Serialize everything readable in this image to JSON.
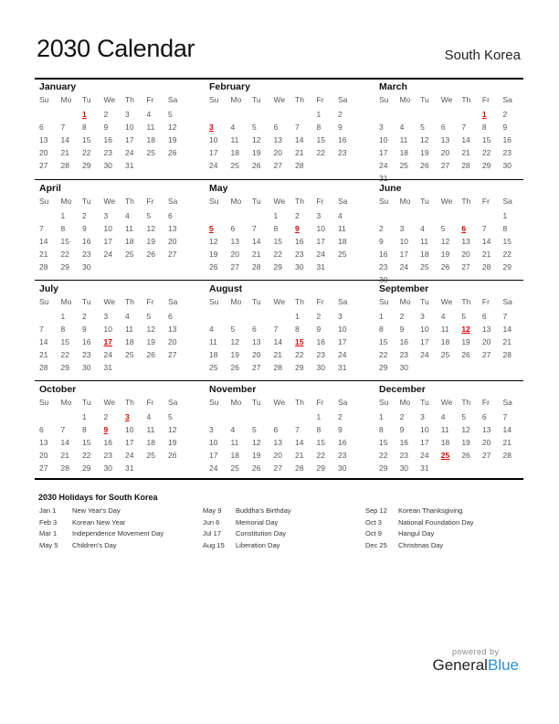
{
  "header": {
    "title": "2030 Calendar",
    "country": "South Korea"
  },
  "weekdays": [
    "Su",
    "Mo",
    "Tu",
    "We",
    "Th",
    "Fr",
    "Sa"
  ],
  "holiday_color": "#e00000",
  "months": [
    {
      "name": "January",
      "weeks": [
        [
          "",
          "",
          "1",
          "2",
          "3",
          "4",
          "5"
        ],
        [
          "6",
          "7",
          "8",
          "9",
          "10",
          "11",
          "12"
        ],
        [
          "13",
          "14",
          "15",
          "16",
          "17",
          "18",
          "19"
        ],
        [
          "20",
          "21",
          "22",
          "23",
          "24",
          "25",
          "26"
        ],
        [
          "27",
          "28",
          "29",
          "30",
          "31",
          "",
          ""
        ]
      ],
      "holidays": [
        "1"
      ]
    },
    {
      "name": "February",
      "weeks": [
        [
          "",
          "",
          "",
          "",
          "",
          "1",
          "2"
        ],
        [
          "3",
          "4",
          "5",
          "6",
          "7",
          "8",
          "9"
        ],
        [
          "10",
          "11",
          "12",
          "13",
          "14",
          "15",
          "16"
        ],
        [
          "17",
          "18",
          "19",
          "20",
          "21",
          "22",
          "23"
        ],
        [
          "24",
          "25",
          "26",
          "27",
          "28",
          "",
          ""
        ]
      ],
      "holidays": [
        "3"
      ]
    },
    {
      "name": "March",
      "weeks": [
        [
          "",
          "",
          "",
          "",
          "",
          "1",
          "2"
        ],
        [
          "3",
          "4",
          "5",
          "6",
          "7",
          "8",
          "9"
        ],
        [
          "10",
          "11",
          "12",
          "13",
          "14",
          "15",
          "16"
        ],
        [
          "17",
          "18",
          "19",
          "20",
          "21",
          "22",
          "23"
        ],
        [
          "24",
          "25",
          "26",
          "27",
          "28",
          "29",
          "30"
        ],
        [
          "31",
          "",
          "",
          "",
          "",
          "",
          ""
        ]
      ],
      "holidays": [
        "1"
      ]
    },
    {
      "name": "April",
      "weeks": [
        [
          "",
          "1",
          "2",
          "3",
          "4",
          "5",
          "6"
        ],
        [
          "7",
          "8",
          "9",
          "10",
          "11",
          "12",
          "13"
        ],
        [
          "14",
          "15",
          "16",
          "17",
          "18",
          "19",
          "20"
        ],
        [
          "21",
          "22",
          "23",
          "24",
          "25",
          "26",
          "27"
        ],
        [
          "28",
          "29",
          "30",
          "",
          "",
          "",
          ""
        ]
      ],
      "holidays": []
    },
    {
      "name": "May",
      "weeks": [
        [
          "",
          "",
          "",
          "1",
          "2",
          "3",
          "4"
        ],
        [
          "5",
          "6",
          "7",
          "8",
          "9",
          "10",
          "11"
        ],
        [
          "12",
          "13",
          "14",
          "15",
          "16",
          "17",
          "18"
        ],
        [
          "19",
          "20",
          "21",
          "22",
          "23",
          "24",
          "25"
        ],
        [
          "26",
          "27",
          "28",
          "29",
          "30",
          "31",
          ""
        ]
      ],
      "holidays": [
        "5",
        "9"
      ]
    },
    {
      "name": "June",
      "weeks": [
        [
          "",
          "",
          "",
          "",
          "",
          "",
          "1"
        ],
        [
          "2",
          "3",
          "4",
          "5",
          "6",
          "7",
          "8"
        ],
        [
          "9",
          "10",
          "11",
          "12",
          "13",
          "14",
          "15"
        ],
        [
          "16",
          "17",
          "18",
          "19",
          "20",
          "21",
          "22"
        ],
        [
          "23",
          "24",
          "25",
          "26",
          "27",
          "28",
          "29"
        ],
        [
          "30",
          "",
          "",
          "",
          "",
          "",
          ""
        ]
      ],
      "holidays": [
        "6"
      ]
    },
    {
      "name": "July",
      "weeks": [
        [
          "",
          "1",
          "2",
          "3",
          "4",
          "5",
          "6"
        ],
        [
          "7",
          "8",
          "9",
          "10",
          "11",
          "12",
          "13"
        ],
        [
          "14",
          "15",
          "16",
          "17",
          "18",
          "19",
          "20"
        ],
        [
          "21",
          "22",
          "23",
          "24",
          "25",
          "26",
          "27"
        ],
        [
          "28",
          "29",
          "30",
          "31",
          "",
          "",
          ""
        ]
      ],
      "holidays": [
        "17"
      ]
    },
    {
      "name": "August",
      "weeks": [
        [
          "",
          "",
          "",
          "",
          "1",
          "2",
          "3"
        ],
        [
          "4",
          "5",
          "6",
          "7",
          "8",
          "9",
          "10"
        ],
        [
          "11",
          "12",
          "13",
          "14",
          "15",
          "16",
          "17"
        ],
        [
          "18",
          "19",
          "20",
          "21",
          "22",
          "23",
          "24"
        ],
        [
          "25",
          "26",
          "27",
          "28",
          "29",
          "30",
          "31"
        ]
      ],
      "holidays": [
        "15"
      ]
    },
    {
      "name": "September",
      "weeks": [
        [
          "1",
          "2",
          "3",
          "4",
          "5",
          "6",
          "7"
        ],
        [
          "8",
          "9",
          "10",
          "11",
          "12",
          "13",
          "14"
        ],
        [
          "15",
          "16",
          "17",
          "18",
          "19",
          "20",
          "21"
        ],
        [
          "22",
          "23",
          "24",
          "25",
          "26",
          "27",
          "28"
        ],
        [
          "29",
          "30",
          "",
          "",
          "",
          "",
          ""
        ]
      ],
      "holidays": [
        "12"
      ]
    },
    {
      "name": "October",
      "weeks": [
        [
          "",
          "",
          "1",
          "2",
          "3",
          "4",
          "5"
        ],
        [
          "6",
          "7",
          "8",
          "9",
          "10",
          "11",
          "12"
        ],
        [
          "13",
          "14",
          "15",
          "16",
          "17",
          "18",
          "19"
        ],
        [
          "20",
          "21",
          "22",
          "23",
          "24",
          "25",
          "26"
        ],
        [
          "27",
          "28",
          "29",
          "30",
          "31",
          "",
          ""
        ]
      ],
      "holidays": [
        "3",
        "9"
      ]
    },
    {
      "name": "November",
      "weeks": [
        [
          "",
          "",
          "",
          "",
          "",
          "1",
          "2"
        ],
        [
          "3",
          "4",
          "5",
          "6",
          "7",
          "8",
          "9"
        ],
        [
          "10",
          "11",
          "12",
          "13",
          "14",
          "15",
          "16"
        ],
        [
          "17",
          "18",
          "19",
          "20",
          "21",
          "22",
          "23"
        ],
        [
          "24",
          "25",
          "26",
          "27",
          "28",
          "29",
          "30"
        ]
      ],
      "holidays": []
    },
    {
      "name": "December",
      "weeks": [
        [
          "1",
          "2",
          "3",
          "4",
          "5",
          "6",
          "7"
        ],
        [
          "8",
          "9",
          "10",
          "11",
          "12",
          "13",
          "14"
        ],
        [
          "15",
          "16",
          "17",
          "18",
          "19",
          "20",
          "21"
        ],
        [
          "22",
          "23",
          "24",
          "25",
          "26",
          "27",
          "28"
        ],
        [
          "29",
          "30",
          "31",
          "",
          "",
          "",
          ""
        ]
      ],
      "holidays": [
        "25"
      ]
    }
  ],
  "holidays_section": {
    "title": "2030 Holidays for South Korea",
    "columns": [
      [
        {
          "date": "Jan 1",
          "name": "New Year's Day"
        },
        {
          "date": "Feb 3",
          "name": "Korean New Year"
        },
        {
          "date": "Mar 1",
          "name": "Independence Movement Day"
        },
        {
          "date": "May 5",
          "name": "Children's Day"
        }
      ],
      [
        {
          "date": "May 9",
          "name": "Buddha's Birthday"
        },
        {
          "date": "Jun 6",
          "name": "Memorial Day"
        },
        {
          "date": "Jul 17",
          "name": "Constitution Day"
        },
        {
          "date": "Aug 15",
          "name": "Liberation Day"
        }
      ],
      [
        {
          "date": "Sep 12",
          "name": "Korean Thanksgiving"
        },
        {
          "date": "Oct 3",
          "name": "National Foundation Day"
        },
        {
          "date": "Oct 9",
          "name": "Hangul Day"
        },
        {
          "date": "Dec 25",
          "name": "Christmas Day"
        }
      ]
    ]
  },
  "branding": {
    "powered_by": "powered by",
    "name_part1": "General",
    "name_part2": "Blue",
    "accent": "#2a8fd0"
  }
}
